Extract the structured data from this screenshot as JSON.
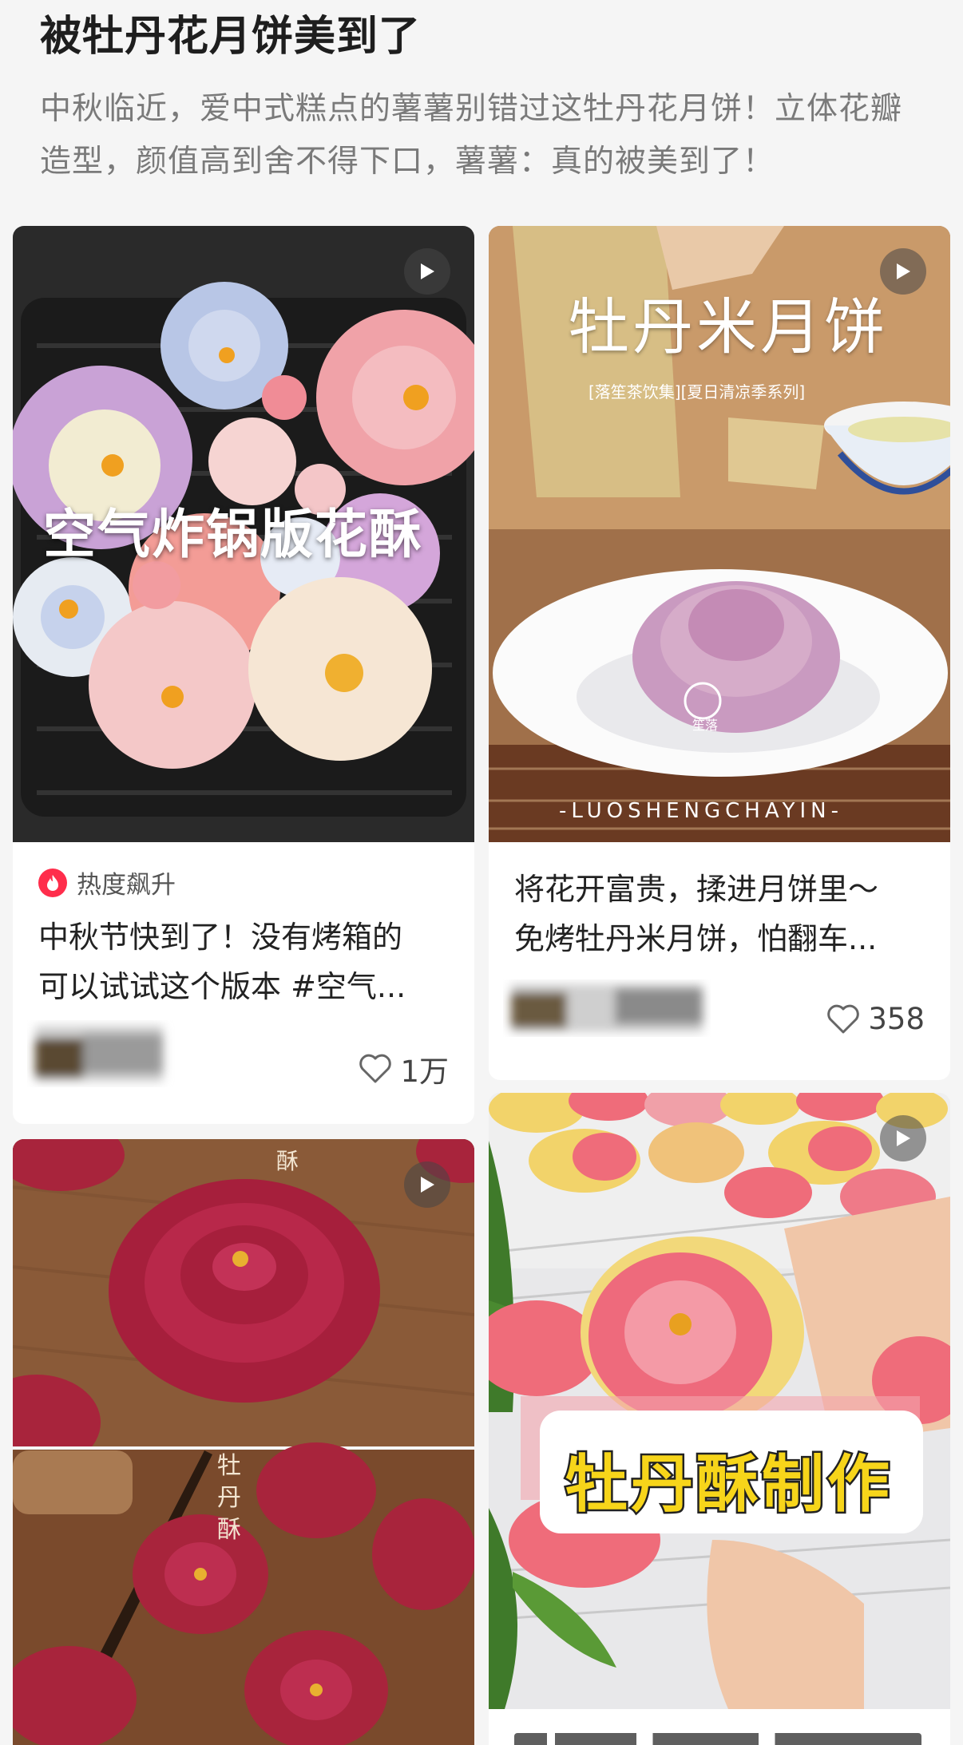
{
  "note": {
    "title": "被牡丹花月饼美到了",
    "description": "中秋临近，爱中式糕点的薯薯别错过这牡丹花月饼！立体花瓣造型，颜值高到舍不得下口，薯薯：真的被美到了！"
  },
  "cards": [
    {
      "overlay_text": "空气炸锅版花酥",
      "badge_label": "热度飙升",
      "title_line1": "中秋节快到了！没有烤箱的",
      "title_line2": "可以试试这个版本 #空气...",
      "likes": "1万"
    },
    {
      "overlay_title": "牡丹米月饼",
      "overlay_subtitle": "[落笙茶饮集][夏日清凉季系列]",
      "overlay_footer": "-LUOSHENGCHAYIN-",
      "seal_text": "笙落",
      "title_line1": "将花开富贵，揉进月饼里～",
      "title_line2": "免烤牡丹米月饼，怕翻车...",
      "likes": "358"
    },
    {
      "vertical_text": "牡丹酥",
      "corner_text": "酥"
    },
    {
      "overlay_label": "牡丹酥制作"
    }
  ],
  "icons": {
    "play": "play-icon",
    "heart": "heart-icon",
    "flame": "flame-icon"
  },
  "colors": {
    "background": "#f5f5f5",
    "hot_badge": "#ff2d4b",
    "text_primary": "#222222",
    "text_secondary": "#7a7a7a"
  }
}
